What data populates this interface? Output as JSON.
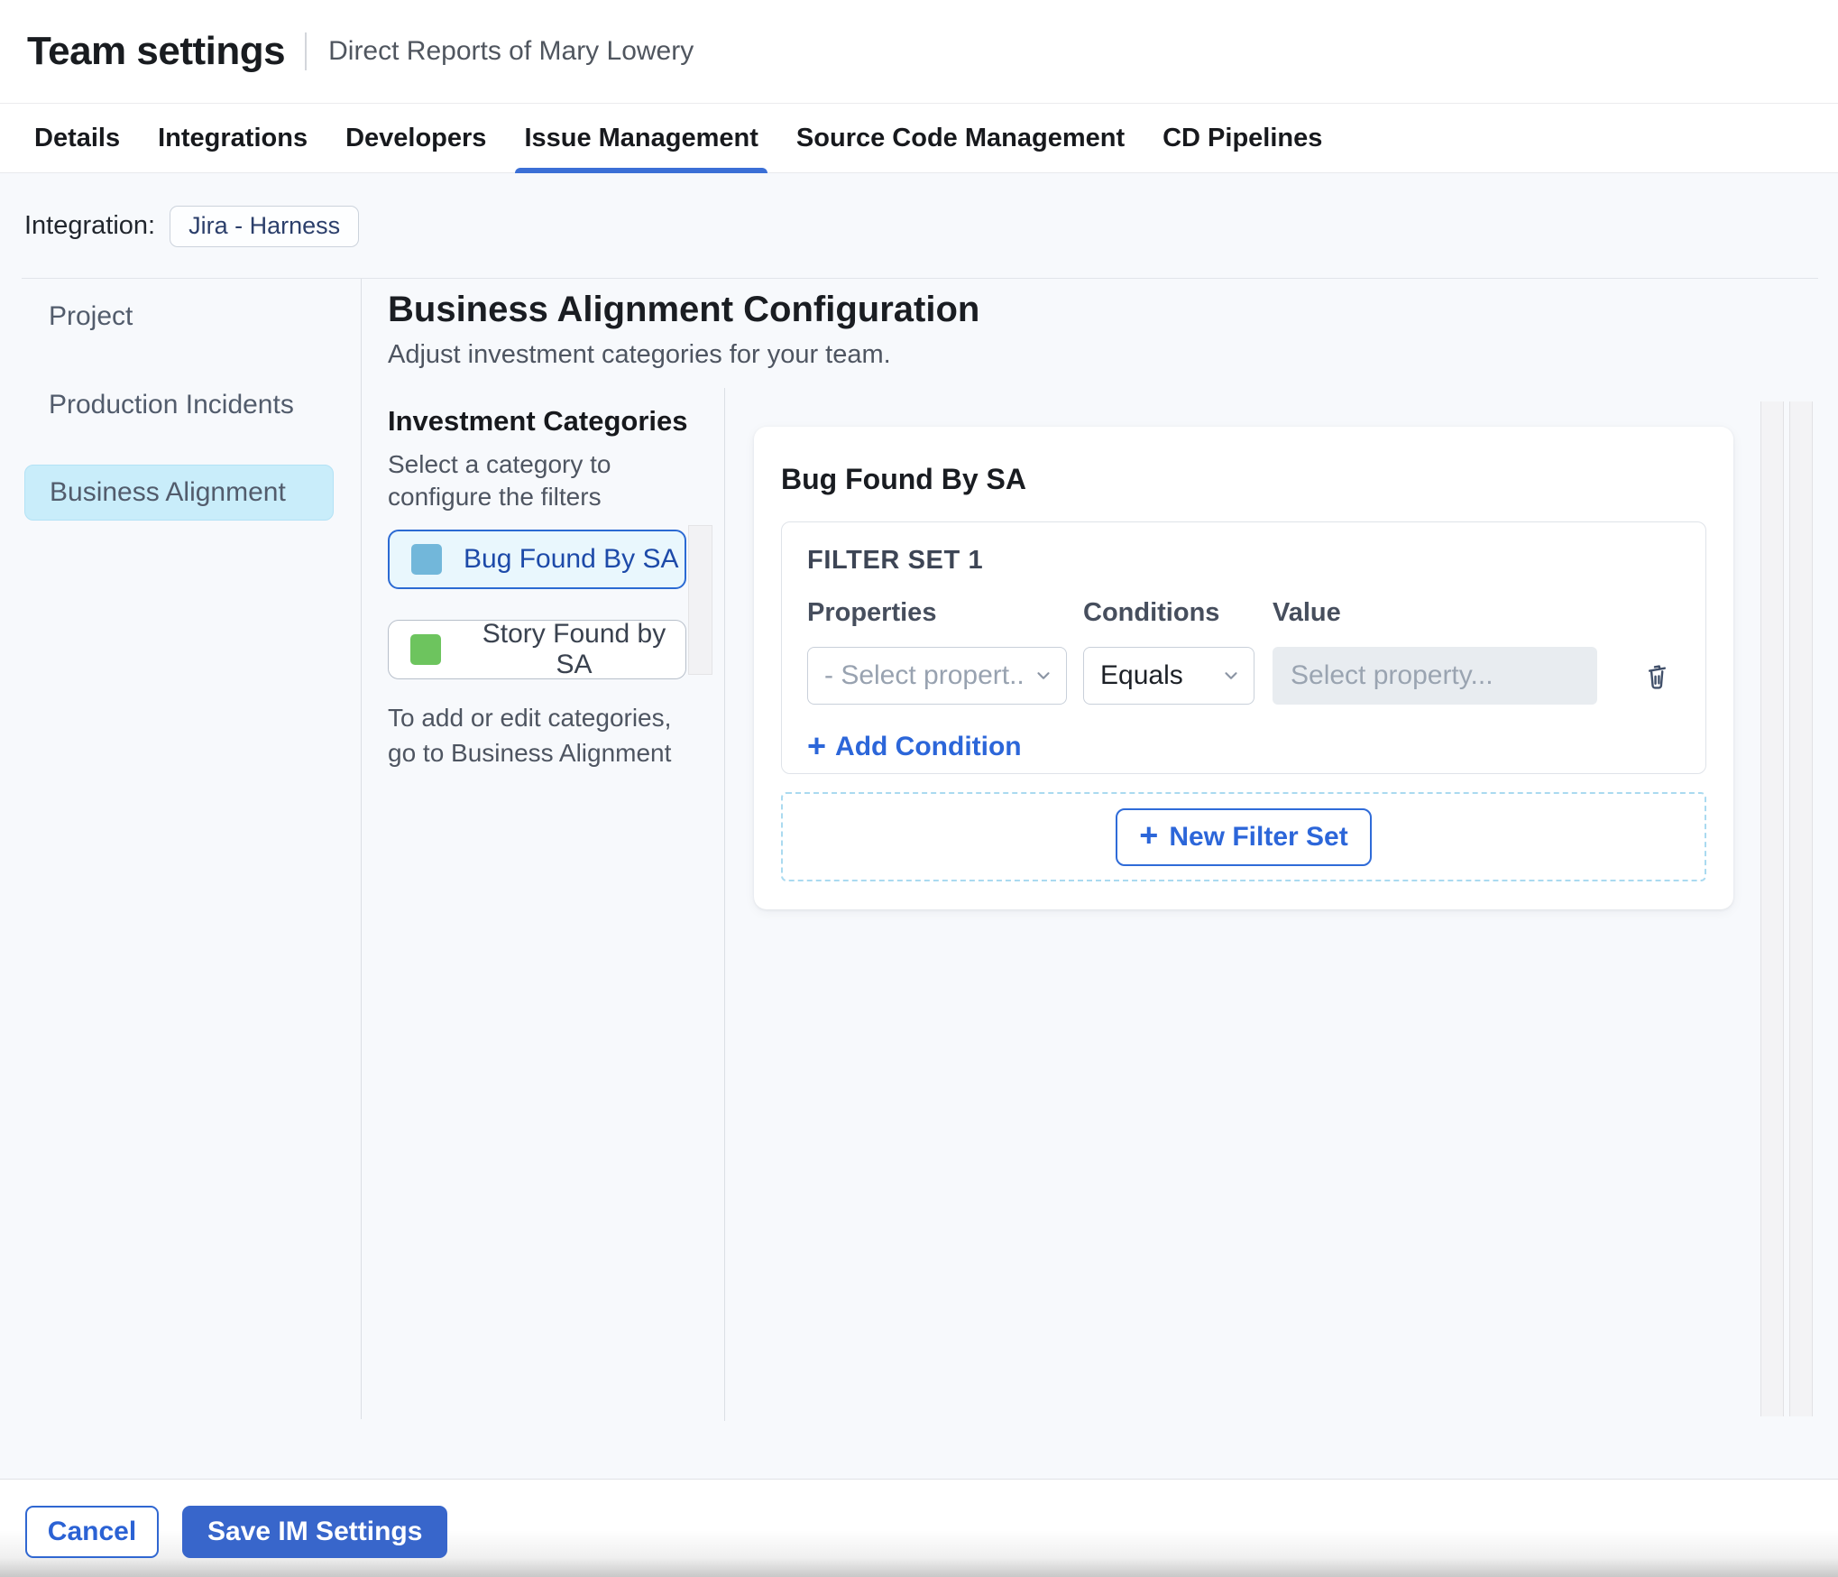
{
  "header": {
    "title": "Team settings",
    "subtitle": "Direct Reports of Mary Lowery"
  },
  "tabs": {
    "items": [
      {
        "label": "Details"
      },
      {
        "label": "Integrations"
      },
      {
        "label": "Developers"
      },
      {
        "label": "Issue Management"
      },
      {
        "label": "Source Code Management"
      },
      {
        "label": "CD Pipelines"
      }
    ],
    "active": "Issue Management"
  },
  "integration": {
    "label": "Integration:",
    "chip": "Jira - Harness"
  },
  "sidebar": {
    "items": [
      "Project",
      "Production Incidents",
      "Business Alignment"
    ],
    "active": "Business Alignment"
  },
  "main": {
    "heading": "Business Alignment Configuration",
    "subheading": "Adjust investment categories for your team.",
    "categories": {
      "title": "Investment Categories",
      "hint": "Select a category to configure the filters",
      "items": [
        {
          "label": "Bug Found By SA",
          "color": "#72b7da",
          "selected": true
        },
        {
          "label": "Story Found by SA",
          "color": "#6dc45e",
          "selected": false
        }
      ],
      "note": "To add or edit categories, go to Business Alignment"
    },
    "panel": {
      "title": "Bug Found By SA",
      "filter_set": {
        "title": "FILTER SET 1",
        "columns": [
          "Properties",
          "Conditions",
          "Value"
        ],
        "property_placeholder": "- Select propert...",
        "condition_value": "Equals",
        "value_placeholder": "Select property...",
        "add_icon": "+",
        "add_condition_label": "Add Condition"
      },
      "new_filter_icon": "+",
      "new_filter_label": "New Filter Set"
    }
  },
  "footer": {
    "cancel_label": "Cancel",
    "save_label": "Save IM Settings"
  },
  "colors": {
    "accent_blue": "#2f6bd8",
    "active_tab_underline": "#3b6fd6",
    "selected_sidebar_bg": "#c9edfa",
    "selected_category_bg": "#e9f7fd",
    "selected_category_border": "#2b6ad3",
    "bug_swatch": "#72b7da",
    "story_swatch": "#6dc45e",
    "save_button_bg": "#3866cb",
    "dashed_border": "#aadaf0",
    "content_bg": "#f7f9fc"
  }
}
